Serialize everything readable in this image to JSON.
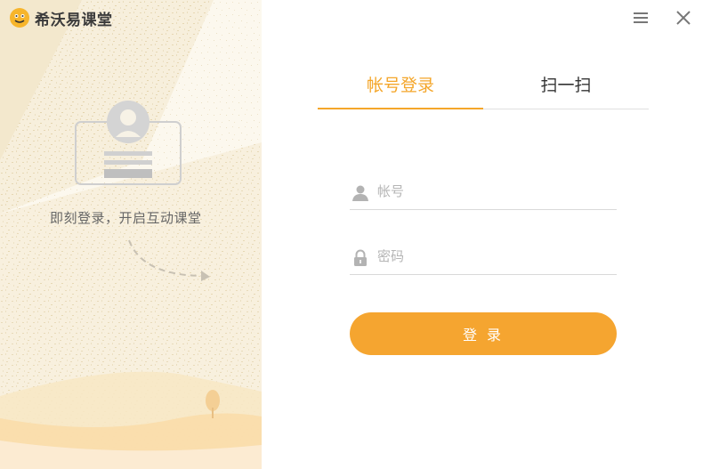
{
  "app": {
    "name": "希沃易课堂"
  },
  "left_panel": {
    "tagline": "即刻登录，开启互动课堂"
  },
  "window_controls": {
    "menu_icon": "hamburger-icon",
    "close_icon": "close-icon"
  },
  "tabs": [
    {
      "label": "帐号登录",
      "active": true
    },
    {
      "label": "扫一扫",
      "active": false
    }
  ],
  "form": {
    "account": {
      "icon": "user-icon",
      "placeholder": "帐号",
      "value": ""
    },
    "password": {
      "icon": "lock-icon",
      "placeholder": "密码",
      "value": ""
    },
    "submit_label": "登 录"
  },
  "colors": {
    "accent": "#f5a530",
    "tab_active": "#f4a62a",
    "left_bg": "#fbf6ea"
  }
}
